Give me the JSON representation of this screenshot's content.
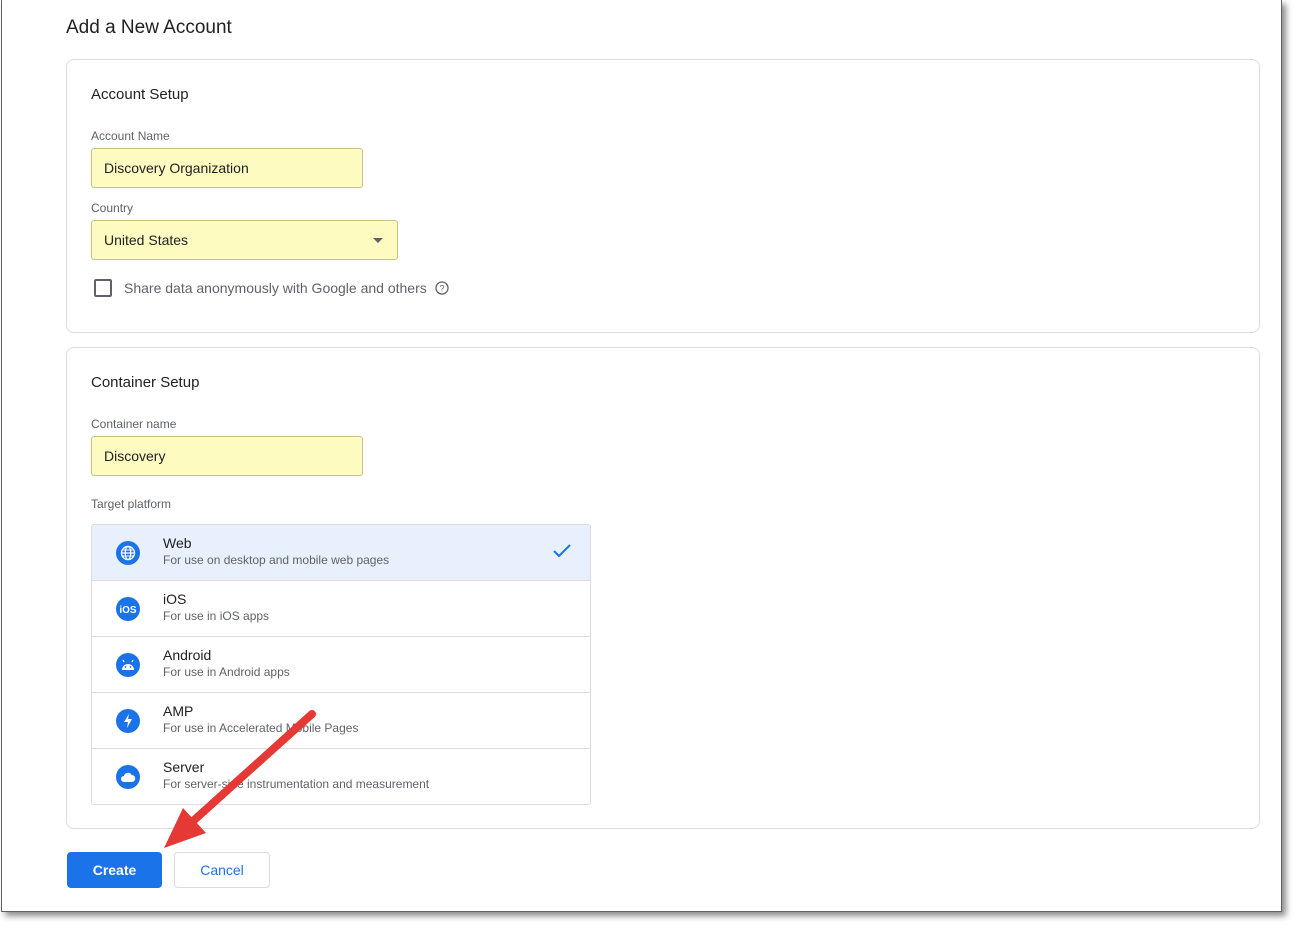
{
  "page": {
    "title": "Add a New Account"
  },
  "account_setup": {
    "title": "Account Setup",
    "account_name_label": "Account Name",
    "account_name_value": "Discovery Organization",
    "country_label": "Country",
    "country_value": "United States",
    "share_data_label": "Share data anonymously with Google and others",
    "share_data_checked": false
  },
  "container_setup": {
    "title": "Container Setup",
    "container_name_label": "Container name",
    "container_name_value": "Discovery",
    "target_platform_label": "Target platform",
    "platforms": [
      {
        "title": "Web",
        "desc": "For use on desktop and mobile web pages",
        "icon": "globe-icon",
        "selected": true
      },
      {
        "title": "iOS",
        "desc": "For use in iOS apps",
        "icon": "ios-icon",
        "selected": false
      },
      {
        "title": "Android",
        "desc": "For use in Android apps",
        "icon": "android-icon",
        "selected": false
      },
      {
        "title": "AMP",
        "desc": "For use in Accelerated Mobile Pages",
        "icon": "lightning-icon",
        "selected": false
      },
      {
        "title": "Server",
        "desc": "For server-side instrumentation and measurement",
        "icon": "cloud-icon",
        "selected": false
      }
    ]
  },
  "actions": {
    "create_label": "Create",
    "cancel_label": "Cancel"
  },
  "colors": {
    "accent": "#1a73e8",
    "highlight_field": "#fdfbc0",
    "selected_row": "#e8f0fe",
    "annotation_arrow": "#e53935"
  }
}
